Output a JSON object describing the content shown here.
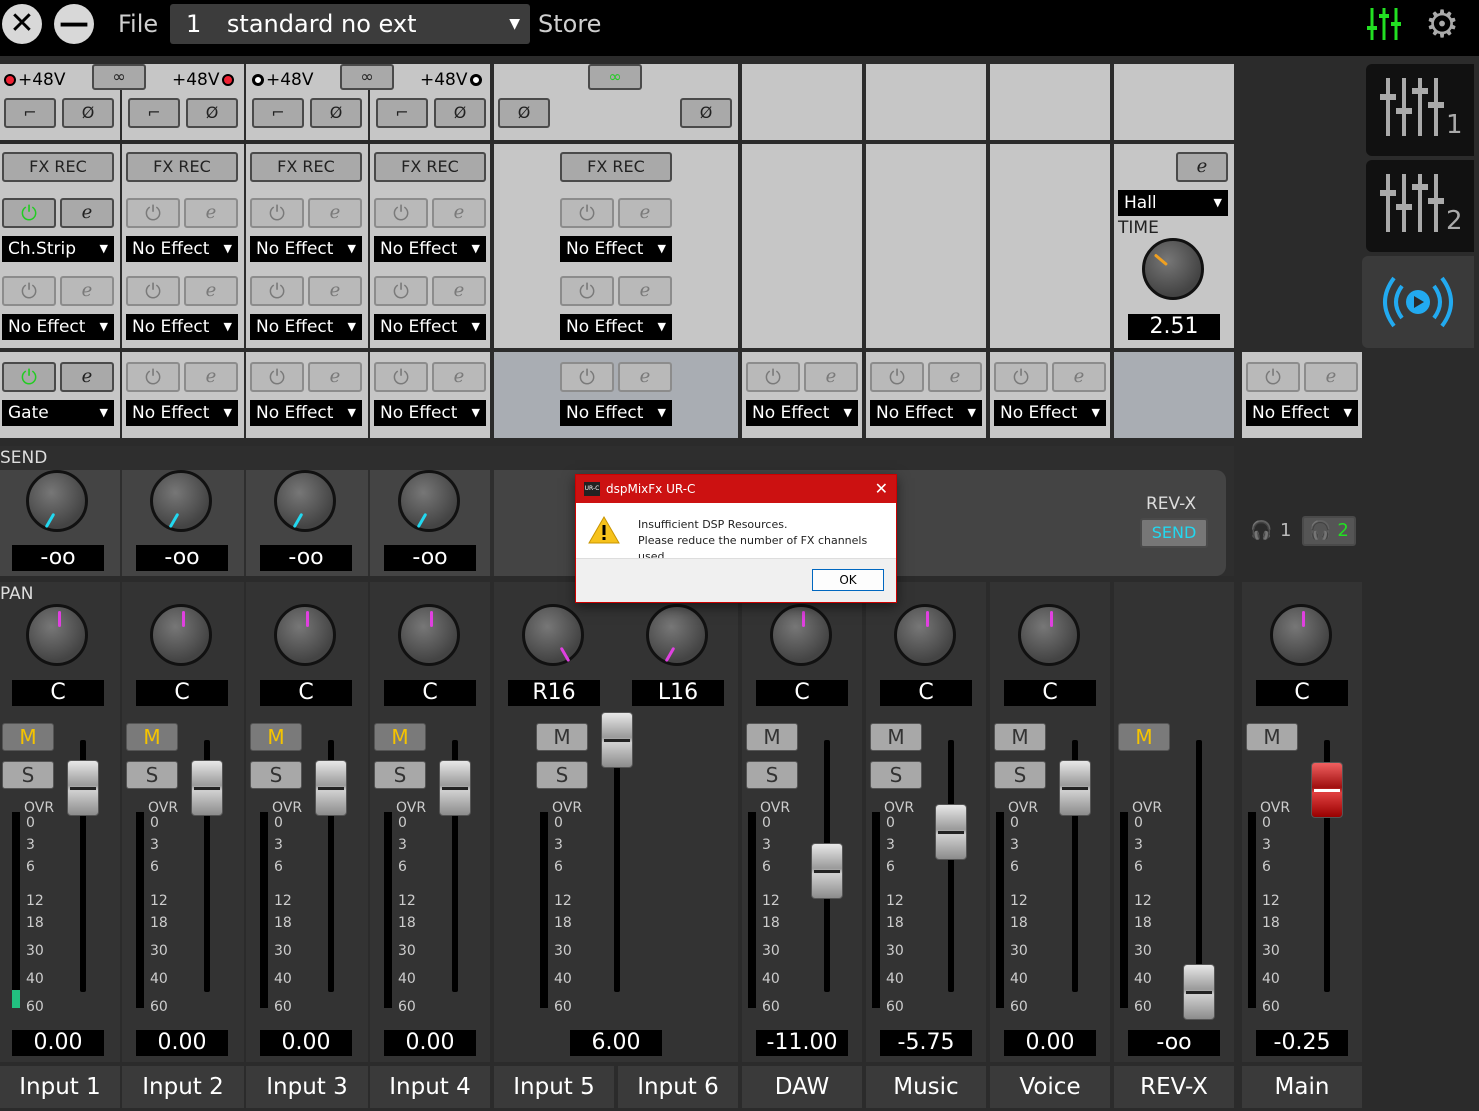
{
  "topbar": {
    "file_label": "File",
    "scene_number": "1",
    "scene_name": "standard no ext",
    "store_label": "Store"
  },
  "dialog": {
    "title": "dspMixFx UR-C",
    "line1": "Insufficient DSP Resources.",
    "line2": "Please reduce the number of FX channels used.",
    "ok_label": "OK",
    "logo_text": "UR-C"
  },
  "phantom": {
    "label": "+48V"
  },
  "fxrec": {
    "label": "FX REC"
  },
  "reverb": {
    "type": "Hall",
    "time_label": "TIME",
    "time_value": "2.51",
    "send_title": "REV-X",
    "send_label": "SEND"
  },
  "sections": {
    "send": "SEND",
    "pan": "PAN",
    "ovr": "OVR"
  },
  "headphones": {
    "hp1": "1",
    "hp2": "2"
  },
  "side_tabs": [
    "1",
    "2"
  ],
  "buttons": {
    "mute": "M",
    "solo": "S"
  },
  "meter_scale": [
    "0",
    "3",
    "6",
    "12",
    "18",
    "30",
    "40",
    "60"
  ],
  "channels": [
    {
      "name": "Input 1",
      "ins1": "Ch.Strip",
      "ins2": "No Effect",
      "ins3": "Gate",
      "send": "-oo",
      "pan": "C",
      "level": "0.00"
    },
    {
      "name": "Input 2",
      "ins1": "No Effect",
      "ins2": "No Effect",
      "ins3": "No Effect",
      "send": "-oo",
      "pan": "C",
      "level": "0.00"
    },
    {
      "name": "Input 3",
      "ins1": "No Effect",
      "ins2": "No Effect",
      "ins3": "No Effect",
      "send": "-oo",
      "pan": "C",
      "level": "0.00"
    },
    {
      "name": "Input 4",
      "ins1": "No Effect",
      "ins2": "No Effect",
      "ins3": "No Effect",
      "send": "-oo",
      "pan": "C",
      "level": "0.00"
    },
    {
      "name": "Input 5",
      "pan": "R16"
    },
    {
      "name": "Input 6",
      "pan": "L16"
    },
    {
      "name": "DAW",
      "ins3": "No Effect",
      "pan": "C",
      "level": "-11.00"
    },
    {
      "name": "Music",
      "ins3": "No Effect",
      "pan": "C",
      "level": "-5.75"
    },
    {
      "name": "Voice",
      "ins3": "No Effect",
      "pan": "C",
      "level": "0.00"
    },
    {
      "name": "REV-X",
      "level": "-oo"
    },
    {
      "name": "Main",
      "ins3": "No Effect",
      "pan": "C",
      "level": "-0.25"
    }
  ],
  "stereo56": {
    "ins1": "No Effect",
    "ins2": "No Effect",
    "ins3": "No Effect",
    "level": "6.00"
  }
}
